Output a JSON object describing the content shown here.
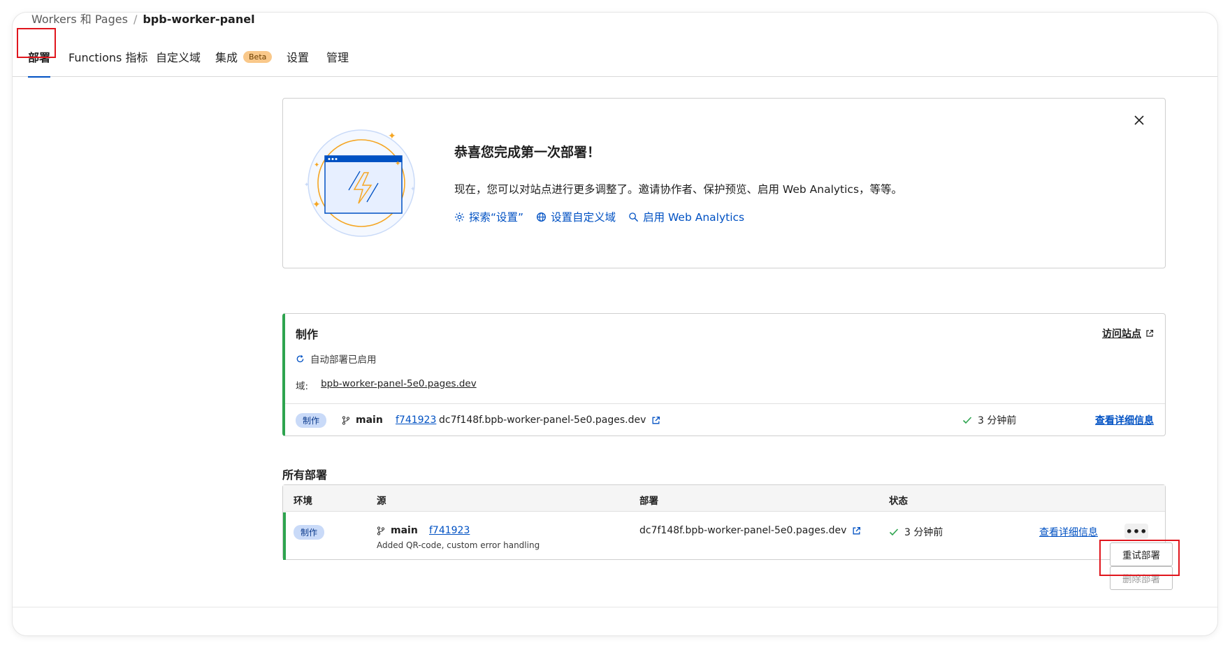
{
  "breadcrumb": {
    "parent": "Workers 和 Pages",
    "separator": "/",
    "current": "bpb-worker-panel"
  },
  "tabs": [
    {
      "label": "部署"
    },
    {
      "label": "Functions 指标"
    },
    {
      "label": "自定义域"
    },
    {
      "label": "集成",
      "badge": "Beta"
    },
    {
      "label": "设置"
    },
    {
      "label": "管理"
    }
  ],
  "banner": {
    "title": "恭喜您完成第一次部署！",
    "body": "现在，您可以对站点进行更多调整了。邀请协作者、保护预览、启用 Web Analytics，等等。",
    "links": [
      {
        "label": "探索“设置”",
        "icon": "gear-icon"
      },
      {
        "label": "设置自定义域",
        "icon": "globe-icon"
      },
      {
        "label": "启用 Web Analytics",
        "icon": "magnifier-icon"
      }
    ]
  },
  "production": {
    "title": "制作",
    "visit_label": "访问站点",
    "auto_deploy": "自动部署已启用",
    "domain_label": "域:",
    "domain": "bpb-worker-panel-5e0.pages.dev",
    "env_badge": "制作",
    "branch": "main",
    "commit": "f741923",
    "deploy_url": "dc7f148f.bpb-worker-panel-5e0.pages.dev",
    "status": "3 分钟前",
    "details_label": "查看详细信息"
  },
  "all_deployments": {
    "title": "所有部署",
    "headers": {
      "env": "环境",
      "source": "源",
      "deployment": "部署",
      "status": "状态"
    },
    "rows": [
      {
        "env": "制作",
        "branch": "main",
        "commit": "f741923",
        "commit_message": "Added QR-code, custom error handling",
        "deploy_url": "dc7f148f.bpb-worker-panel-5e0.pages.dev",
        "status": "3 分钟前",
        "details_label": "查看详细信息",
        "more_label": "•••"
      }
    ]
  },
  "menu": {
    "retry": "重试部署",
    "delete": "删除部署"
  },
  "colors": {
    "accent": "#0051c3",
    "success": "#2ea44f",
    "highlight": "#e0161d",
    "badge": "#f9c88a"
  }
}
